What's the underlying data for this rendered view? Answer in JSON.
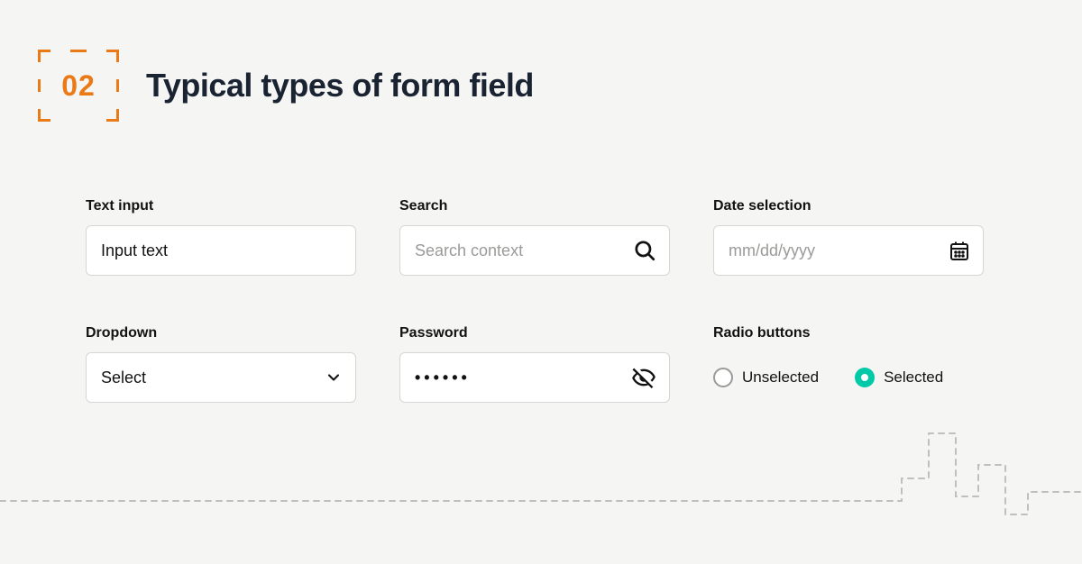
{
  "header": {
    "num": "02",
    "title": "Typical types of form field"
  },
  "fields": {
    "text_input": {
      "label": "Text input",
      "value": "Input text"
    },
    "search": {
      "label": "Search",
      "placeholder": "Search context"
    },
    "date": {
      "label": "Date selection",
      "placeholder": "mm/dd/yyyy"
    },
    "dropdown": {
      "label": "Dropdown",
      "value": "Select"
    },
    "password": {
      "label": "Password",
      "masked": "••••••"
    },
    "radio": {
      "label": "Radio buttons",
      "options": {
        "unselected": "Unselected",
        "selected": "Selected"
      }
    }
  }
}
